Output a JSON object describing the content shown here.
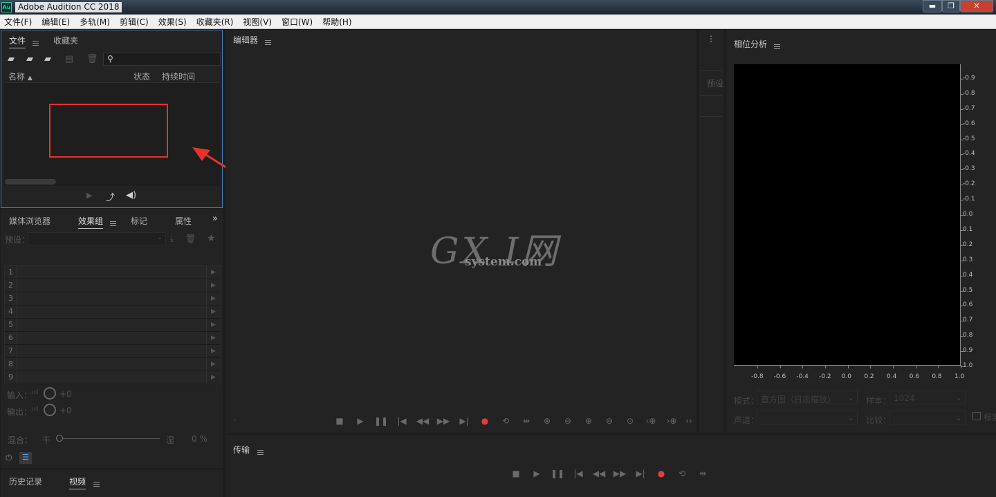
{
  "window": {
    "title": "Adobe Audition CC 2018",
    "app_icon": "Au"
  },
  "menubar": [
    "文件(F)",
    "编辑(E)",
    "多轨(M)",
    "剪辑(C)",
    "效果(S)",
    "收藏夹(R)",
    "视图(V)",
    "窗口(W)",
    "帮助(H)"
  ],
  "files_panel": {
    "tabs": [
      "文件",
      "收藏夹"
    ],
    "columns": [
      "名称",
      "状态",
      "持续时间"
    ]
  },
  "effects_panel": {
    "tabs": [
      "媒体浏览器",
      "效果组",
      "标记",
      "属性"
    ],
    "preset_label": "预设：",
    "rows": [
      "1",
      "2",
      "3",
      "4",
      "5",
      "6",
      "7",
      "8",
      "9"
    ],
    "input_label": "输入：",
    "output_label": "输出：",
    "input_value": "+0",
    "output_value": "+0",
    "mix_label": "混合：",
    "dry_label": "干",
    "wet_label": "湿",
    "mix_value": "0 %"
  },
  "bottom_left": {
    "tabs": [
      "历史记录",
      "视频"
    ]
  },
  "editor": {
    "title": "编辑器",
    "bottom_left_mark": "-"
  },
  "narrow_panel": {
    "label": "预设"
  },
  "watermark": {
    "big": "GX I网",
    "small": "system.com"
  },
  "phase_panel": {
    "title": "相位分析",
    "y_ticks": [
      "-0.9",
      "-0.8",
      "-0.7",
      "-0.6",
      "-0.5",
      "-0.4",
      "-0.3",
      "-0.2",
      "-0.1",
      "0.0",
      "0.1",
      "0.2",
      "0.3",
      "0.4",
      "0.5",
      "0.6",
      "0.7",
      "0.8",
      "0.9",
      "1.0"
    ],
    "x_ticks": [
      "-0.8",
      "-0.6",
      "-0.4",
      "-0.2",
      "0.0",
      "0.2",
      "0.4",
      "0.6",
      "0.8",
      "1.0"
    ],
    "mode_label": "模式：",
    "mode_value": "直方图（日志缩放）",
    "sample_label": "样本：",
    "sample_value": "1024",
    "channel_label": "声道：",
    "compare_label": "比较：",
    "checkbox_label": "标准"
  },
  "transport": {
    "title": "传输"
  },
  "colors": {
    "record": "#e53b3b",
    "highlight_box": "#e8312a",
    "panel_focus": "#4a7dc0"
  }
}
